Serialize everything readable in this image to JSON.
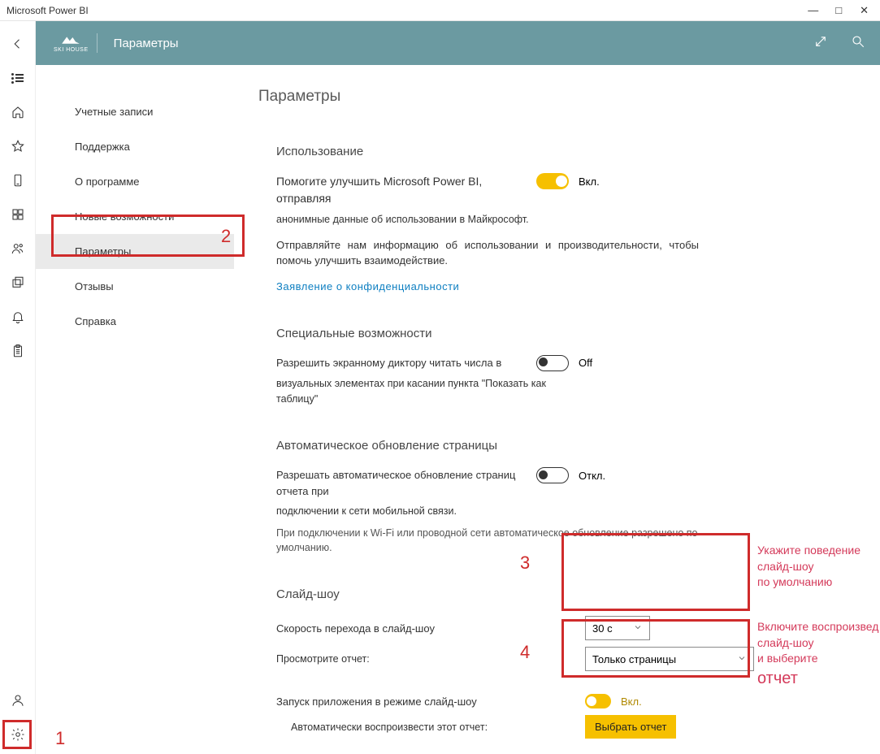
{
  "window_title": "Microsoft Power BI",
  "logo_text": "SKI HOUSE",
  "header_title": "Параметры",
  "menu": {
    "items": [
      {
        "label": "Учетные записи"
      },
      {
        "label": "Поддержка"
      },
      {
        "label": "О программе"
      },
      {
        "label": "Новые возможности"
      },
      {
        "label": "Параметры"
      },
      {
        "label": "Отзывы"
      },
      {
        "label": "Справка"
      }
    ]
  },
  "panel_title": "Параметры",
  "usage": {
    "title": "Использование",
    "line1": "Помогите улучшить Microsoft Power BI, отправляя",
    "line2": "анонимные данные об использовании в Майкрософт.",
    "toggle_label": "Вкл.",
    "help": "Отправляйте нам информацию об использовании и производительности, чтобы помочь улучшить взаимодействие.",
    "link": "Заявление о конфиденциальности"
  },
  "accessibility": {
    "title": "Специальные возможности",
    "line1": "Разрешить экранному диктору читать числа в",
    "line2": "визуальных элементах при касании пункта \"Показать как таблицу\"",
    "toggle_label": "Off"
  },
  "autorefresh": {
    "title": "Автоматическое обновление страницы",
    "line1": "Разрешать автоматическое обновление страниц отчета при",
    "line2": "подключении к сети мобильной связи.",
    "toggle_label": "Откл.",
    "note": "При подключении к Wi-Fi или проводной сети автоматическое обновление разрешено по умолчанию."
  },
  "slideshow": {
    "title": "Слайд-шоу",
    "speed_label": "Скорость перехода в слайд-шоу",
    "view_label": "Просмотрите отчет:",
    "speed_value": "30 с",
    "view_value": "Только страницы",
    "launch_label": "Запуск приложения в режиме слайд-шоу",
    "launch_toggle": "Вкл.",
    "autoplay_label": "Автоматически воспроизвести этот отчет:",
    "button": "Выбрать отчет"
  },
  "annotations": {
    "n1": "1",
    "n2": "2",
    "n3": "3",
    "n4": "4",
    "t1a": "Укажите поведение",
    "t1b": "слайд-шоу",
    "t1c": "по умолчанию",
    "t2a": "Включите воспроизвед",
    "t2b": "слайд-шоу",
    "t2c": "и выберите",
    "t2d": "отчет"
  }
}
